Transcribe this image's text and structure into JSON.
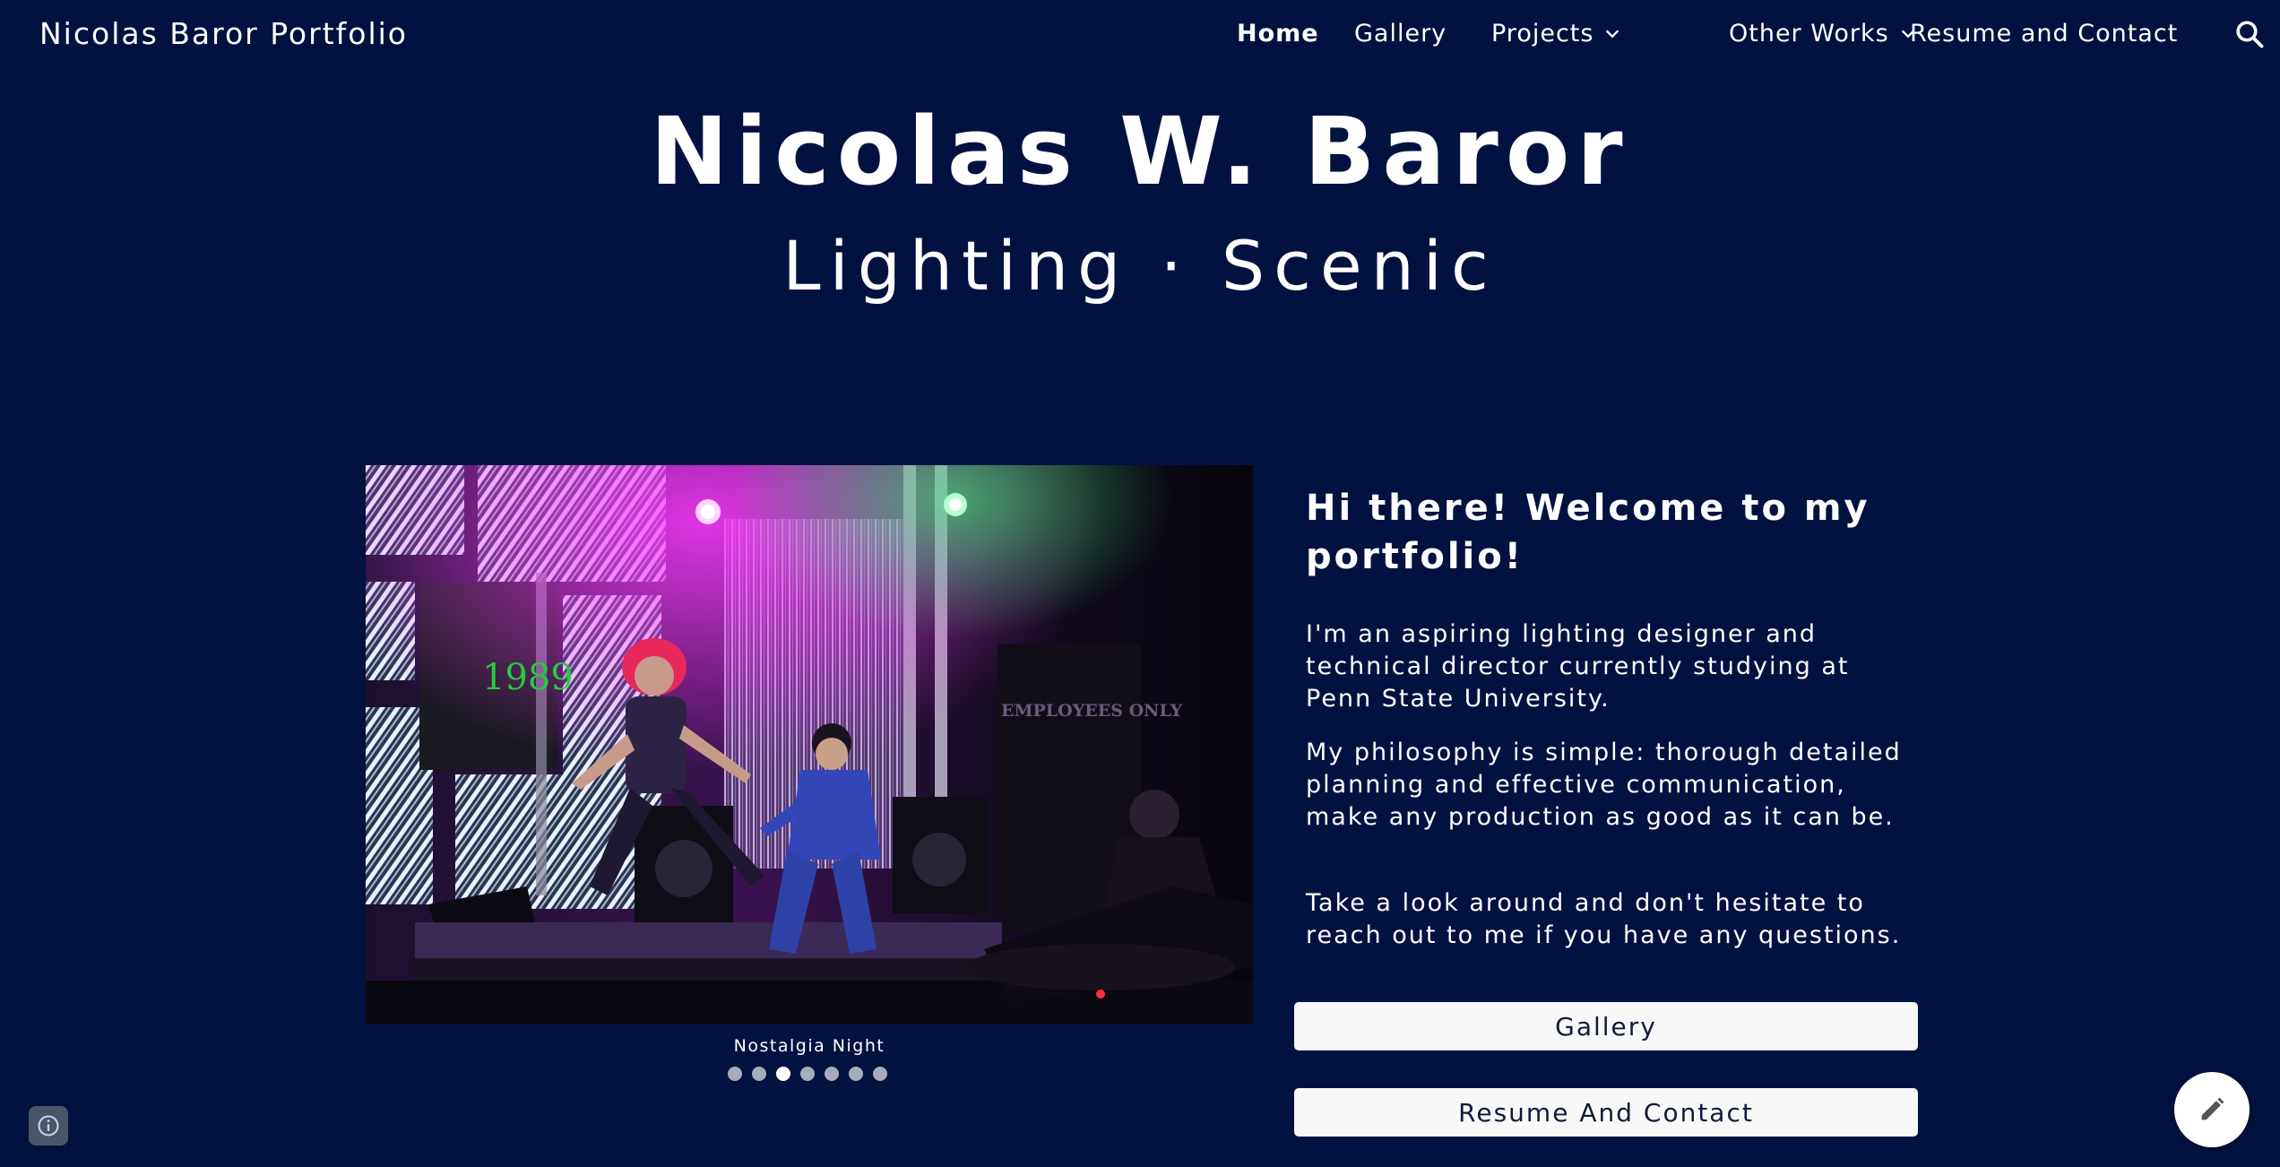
{
  "site": {
    "title": "Nicolas Baror Portfolio"
  },
  "nav": {
    "items": [
      {
        "label": "Home",
        "active": true
      },
      {
        "label": "Gallery"
      },
      {
        "label": "Projects",
        "has_dropdown": true
      },
      {
        "label": "Other Works",
        "has_dropdown": true
      },
      {
        "label": "Resume and Contact"
      }
    ],
    "search_icon": "search-icon"
  },
  "hero": {
    "name": "Nicolas W. Baror",
    "subtitle": "Lighting · Scenic"
  },
  "slideshow": {
    "caption": "Nostalgia Night",
    "dot_count": 7,
    "active_index": 2,
    "image_text": {
      "year": "1989",
      "sign": "EMPLOYEES ONLY"
    }
  },
  "intro": {
    "heading": "Hi there! Welcome to my portfolio!",
    "paragraphs": [
      "I'm an aspiring lighting designer and technical director currently studying at Penn State University.",
      "My philosophy is simple: thorough detailed planning and effective communication, make any production as good as it can be.",
      "Take a look around and don't hesitate to reach out to me if you have any questions."
    ]
  },
  "buttons": {
    "gallery": "Gallery",
    "resume": "Resume And Contact"
  },
  "colors": {
    "background": "#021240",
    "button_bg": "#f8f8f8",
    "text": "#ffffff"
  }
}
